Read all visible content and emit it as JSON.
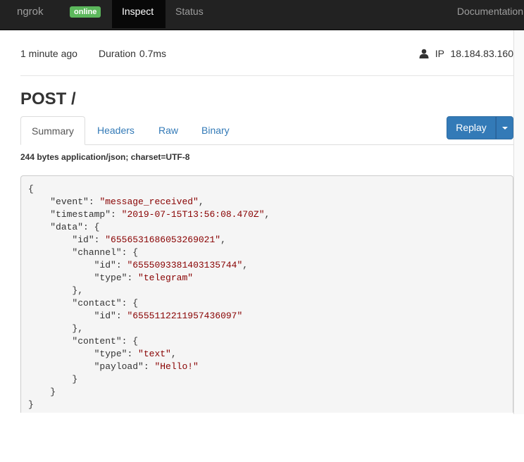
{
  "navbar": {
    "brand": "ngrok",
    "status_badge": "online",
    "links": {
      "inspect": "Inspect",
      "status": "Status",
      "documentation": "Documentation"
    }
  },
  "request": {
    "time_ago": "1 minute ago",
    "duration_label": "Duration",
    "duration_value": "0.7ms",
    "ip_label": "IP",
    "ip_value": "18.184.83.160",
    "title": "POST /"
  },
  "tabs": {
    "summary": "Summary",
    "headers": "Headers",
    "raw": "Raw",
    "binary": "Binary"
  },
  "replay_label": "Replay",
  "body_info": "244 bytes application/json; charset=UTF-8",
  "code": {
    "l1": "{",
    "l2_key": "\"event\"",
    "l2_val": "\"message_received\"",
    "l3_key": "\"timestamp\"",
    "l3_val": "\"2019-07-15T13:56:08.470Z\"",
    "l4_key": "\"data\"",
    "l5_key": "\"id\"",
    "l5_val": "\"6556531686053269021\"",
    "l6_key": "\"channel\"",
    "l7_key": "\"id\"",
    "l7_val": "\"6555093381403135744\"",
    "l8_key": "\"type\"",
    "l8_val": "\"telegram\"",
    "l10_key": "\"contact\"",
    "l11_key": "\"id\"",
    "l11_val": "\"6555112211957436097\"",
    "l13_key": "\"content\"",
    "l14_key": "\"type\"",
    "l14_val": "\"text\"",
    "l15_key": "\"payload\"",
    "l15_val": "\"Hello!\""
  },
  "colors": {
    "navbar_bg": "#222222",
    "online_badge": "#5cb85c",
    "primary_button": "#337ab7",
    "json_string": "#880000",
    "link": "#337ab7"
  },
  "icons": {
    "user": "user-icon",
    "dropdown": "caret-down-icon"
  }
}
